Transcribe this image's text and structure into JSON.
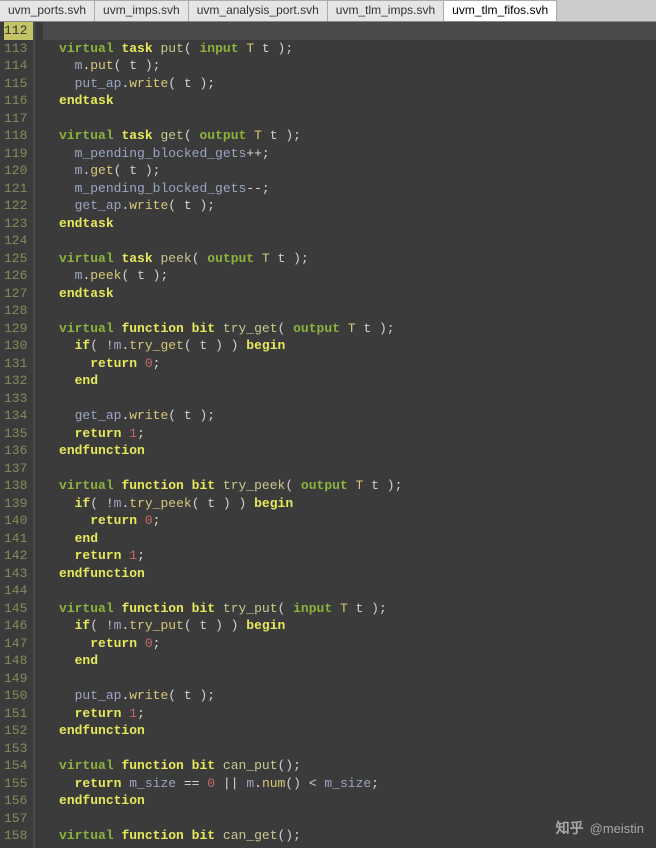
{
  "tabs": [
    {
      "label": "uvm_ports.svh",
      "active": false
    },
    {
      "label": "uvm_imps.svh",
      "active": false
    },
    {
      "label": "uvm_analysis_port.svh",
      "active": false
    },
    {
      "label": "uvm_tlm_imps.svh",
      "active": false
    },
    {
      "label": "uvm_tlm_fifos.svh",
      "active": true
    }
  ],
  "line_start": 112,
  "line_end": 158,
  "highlight_line": 112,
  "code_lines": [
    {
      "n": 112,
      "tokens": []
    },
    {
      "n": 113,
      "tokens": [
        {
          "t": "  ",
          "c": ""
        },
        {
          "t": "virtual",
          "c": "kw"
        },
        {
          "t": " ",
          "c": ""
        },
        {
          "t": "task",
          "c": "kw2"
        },
        {
          "t": " ",
          "c": ""
        },
        {
          "t": "put",
          "c": "fn"
        },
        {
          "t": "( ",
          "c": "paren"
        },
        {
          "t": "input",
          "c": "kw"
        },
        {
          "t": " ",
          "c": ""
        },
        {
          "t": "T",
          "c": "type"
        },
        {
          "t": " t );",
          "c": "paren"
        }
      ]
    },
    {
      "n": 114,
      "tokens": [
        {
          "t": "    ",
          "c": ""
        },
        {
          "t": "m",
          "c": "ident"
        },
        {
          "t": ".",
          "c": "op"
        },
        {
          "t": "put",
          "c": "call"
        },
        {
          "t": "( t );",
          "c": "paren"
        }
      ]
    },
    {
      "n": 115,
      "tokens": [
        {
          "t": "    ",
          "c": ""
        },
        {
          "t": "put_ap",
          "c": "ident"
        },
        {
          "t": ".",
          "c": "op"
        },
        {
          "t": "write",
          "c": "call"
        },
        {
          "t": "( t );",
          "c": "paren"
        }
      ]
    },
    {
      "n": 116,
      "tokens": [
        {
          "t": "  ",
          "c": ""
        },
        {
          "t": "endtask",
          "c": "kw2"
        }
      ]
    },
    {
      "n": 117,
      "tokens": []
    },
    {
      "n": 118,
      "tokens": [
        {
          "t": "  ",
          "c": ""
        },
        {
          "t": "virtual",
          "c": "kw"
        },
        {
          "t": " ",
          "c": ""
        },
        {
          "t": "task",
          "c": "kw2"
        },
        {
          "t": " ",
          "c": ""
        },
        {
          "t": "get",
          "c": "fn"
        },
        {
          "t": "( ",
          "c": "paren"
        },
        {
          "t": "output",
          "c": "kw"
        },
        {
          "t": " ",
          "c": ""
        },
        {
          "t": "T",
          "c": "type"
        },
        {
          "t": " t );",
          "c": "paren"
        }
      ]
    },
    {
      "n": 119,
      "tokens": [
        {
          "t": "    ",
          "c": ""
        },
        {
          "t": "m_pending_blocked_gets",
          "c": "ident"
        },
        {
          "t": "++;",
          "c": "op"
        }
      ]
    },
    {
      "n": 120,
      "tokens": [
        {
          "t": "    ",
          "c": ""
        },
        {
          "t": "m",
          "c": "ident"
        },
        {
          "t": ".",
          "c": "op"
        },
        {
          "t": "get",
          "c": "call"
        },
        {
          "t": "( t );",
          "c": "paren"
        }
      ]
    },
    {
      "n": 121,
      "tokens": [
        {
          "t": "    ",
          "c": ""
        },
        {
          "t": "m_pending_blocked_gets",
          "c": "ident"
        },
        {
          "t": "--;",
          "c": "op"
        }
      ]
    },
    {
      "n": 122,
      "tokens": [
        {
          "t": "    ",
          "c": ""
        },
        {
          "t": "get_ap",
          "c": "ident"
        },
        {
          "t": ".",
          "c": "op"
        },
        {
          "t": "write",
          "c": "call"
        },
        {
          "t": "( t );",
          "c": "paren"
        }
      ]
    },
    {
      "n": 123,
      "tokens": [
        {
          "t": "  ",
          "c": ""
        },
        {
          "t": "endtask",
          "c": "kw2"
        }
      ]
    },
    {
      "n": 124,
      "tokens": []
    },
    {
      "n": 125,
      "tokens": [
        {
          "t": "  ",
          "c": ""
        },
        {
          "t": "virtual",
          "c": "kw"
        },
        {
          "t": " ",
          "c": ""
        },
        {
          "t": "task",
          "c": "kw2"
        },
        {
          "t": " ",
          "c": ""
        },
        {
          "t": "peek",
          "c": "fn"
        },
        {
          "t": "( ",
          "c": "paren"
        },
        {
          "t": "output",
          "c": "kw"
        },
        {
          "t": " ",
          "c": ""
        },
        {
          "t": "T",
          "c": "type"
        },
        {
          "t": " t );",
          "c": "paren"
        }
      ]
    },
    {
      "n": 126,
      "tokens": [
        {
          "t": "    ",
          "c": ""
        },
        {
          "t": "m",
          "c": "ident"
        },
        {
          "t": ".",
          "c": "op"
        },
        {
          "t": "peek",
          "c": "call"
        },
        {
          "t": "( t );",
          "c": "paren"
        }
      ]
    },
    {
      "n": 127,
      "tokens": [
        {
          "t": "  ",
          "c": ""
        },
        {
          "t": "endtask",
          "c": "kw2"
        }
      ]
    },
    {
      "n": 128,
      "tokens": []
    },
    {
      "n": 129,
      "tokens": [
        {
          "t": "  ",
          "c": ""
        },
        {
          "t": "virtual",
          "c": "kw"
        },
        {
          "t": " ",
          "c": ""
        },
        {
          "t": "function",
          "c": "kw2"
        },
        {
          "t": " ",
          "c": ""
        },
        {
          "t": "bit",
          "c": "kw2"
        },
        {
          "t": " ",
          "c": ""
        },
        {
          "t": "try_get",
          "c": "fn"
        },
        {
          "t": "( ",
          "c": "paren"
        },
        {
          "t": "output",
          "c": "kw"
        },
        {
          "t": " ",
          "c": ""
        },
        {
          "t": "T",
          "c": "type"
        },
        {
          "t": " t );",
          "c": "paren"
        }
      ]
    },
    {
      "n": 130,
      "tokens": [
        {
          "t": "    ",
          "c": ""
        },
        {
          "t": "if",
          "c": "kw2"
        },
        {
          "t": "( !",
          "c": "paren"
        },
        {
          "t": "m",
          "c": "ident"
        },
        {
          "t": ".",
          "c": "op"
        },
        {
          "t": "try_get",
          "c": "call"
        },
        {
          "t": "( t ) ) ",
          "c": "paren"
        },
        {
          "t": "begin",
          "c": "kw2"
        }
      ]
    },
    {
      "n": 131,
      "tokens": [
        {
          "t": "      ",
          "c": ""
        },
        {
          "t": "return",
          "c": "kw2"
        },
        {
          "t": " ",
          "c": ""
        },
        {
          "t": "0",
          "c": "num"
        },
        {
          "t": ";",
          "c": "op"
        }
      ]
    },
    {
      "n": 132,
      "tokens": [
        {
          "t": "    ",
          "c": ""
        },
        {
          "t": "end",
          "c": "kw2"
        }
      ]
    },
    {
      "n": 133,
      "tokens": []
    },
    {
      "n": 134,
      "tokens": [
        {
          "t": "    ",
          "c": ""
        },
        {
          "t": "get_ap",
          "c": "ident"
        },
        {
          "t": ".",
          "c": "op"
        },
        {
          "t": "write",
          "c": "call"
        },
        {
          "t": "( t );",
          "c": "paren"
        }
      ]
    },
    {
      "n": 135,
      "tokens": [
        {
          "t": "    ",
          "c": ""
        },
        {
          "t": "return",
          "c": "kw2"
        },
        {
          "t": " ",
          "c": ""
        },
        {
          "t": "1",
          "c": "num"
        },
        {
          "t": ";",
          "c": "op"
        }
      ]
    },
    {
      "n": 136,
      "tokens": [
        {
          "t": "  ",
          "c": ""
        },
        {
          "t": "endfunction",
          "c": "kw2"
        }
      ]
    },
    {
      "n": 137,
      "tokens": []
    },
    {
      "n": 138,
      "tokens": [
        {
          "t": "  ",
          "c": ""
        },
        {
          "t": "virtual",
          "c": "kw"
        },
        {
          "t": " ",
          "c": ""
        },
        {
          "t": "function",
          "c": "kw2"
        },
        {
          "t": " ",
          "c": ""
        },
        {
          "t": "bit",
          "c": "kw2"
        },
        {
          "t": " ",
          "c": ""
        },
        {
          "t": "try_peek",
          "c": "fn"
        },
        {
          "t": "( ",
          "c": "paren"
        },
        {
          "t": "output",
          "c": "kw"
        },
        {
          "t": " ",
          "c": ""
        },
        {
          "t": "T",
          "c": "type"
        },
        {
          "t": " t );",
          "c": "paren"
        }
      ]
    },
    {
      "n": 139,
      "tokens": [
        {
          "t": "    ",
          "c": ""
        },
        {
          "t": "if",
          "c": "kw2"
        },
        {
          "t": "( !",
          "c": "paren"
        },
        {
          "t": "m",
          "c": "ident"
        },
        {
          "t": ".",
          "c": "op"
        },
        {
          "t": "try_peek",
          "c": "call"
        },
        {
          "t": "( t ) ) ",
          "c": "paren"
        },
        {
          "t": "begin",
          "c": "kw2"
        }
      ]
    },
    {
      "n": 140,
      "tokens": [
        {
          "t": "      ",
          "c": ""
        },
        {
          "t": "return",
          "c": "kw2"
        },
        {
          "t": " ",
          "c": ""
        },
        {
          "t": "0",
          "c": "num"
        },
        {
          "t": ";",
          "c": "op"
        }
      ]
    },
    {
      "n": 141,
      "tokens": [
        {
          "t": "    ",
          "c": ""
        },
        {
          "t": "end",
          "c": "kw2"
        }
      ]
    },
    {
      "n": 142,
      "tokens": [
        {
          "t": "    ",
          "c": ""
        },
        {
          "t": "return",
          "c": "kw2"
        },
        {
          "t": " ",
          "c": ""
        },
        {
          "t": "1",
          "c": "num"
        },
        {
          "t": ";",
          "c": "op"
        }
      ]
    },
    {
      "n": 143,
      "tokens": [
        {
          "t": "  ",
          "c": ""
        },
        {
          "t": "endfunction",
          "c": "kw2"
        }
      ]
    },
    {
      "n": 144,
      "tokens": []
    },
    {
      "n": 145,
      "tokens": [
        {
          "t": "  ",
          "c": ""
        },
        {
          "t": "virtual",
          "c": "kw"
        },
        {
          "t": " ",
          "c": ""
        },
        {
          "t": "function",
          "c": "kw2"
        },
        {
          "t": " ",
          "c": ""
        },
        {
          "t": "bit",
          "c": "kw2"
        },
        {
          "t": " ",
          "c": ""
        },
        {
          "t": "try_put",
          "c": "fn"
        },
        {
          "t": "( ",
          "c": "paren"
        },
        {
          "t": "input",
          "c": "kw"
        },
        {
          "t": " ",
          "c": ""
        },
        {
          "t": "T",
          "c": "type"
        },
        {
          "t": " t );",
          "c": "paren"
        }
      ]
    },
    {
      "n": 146,
      "tokens": [
        {
          "t": "    ",
          "c": ""
        },
        {
          "t": "if",
          "c": "kw2"
        },
        {
          "t": "( !",
          "c": "paren"
        },
        {
          "t": "m",
          "c": "ident"
        },
        {
          "t": ".",
          "c": "op"
        },
        {
          "t": "try_put",
          "c": "call"
        },
        {
          "t": "( t ) ) ",
          "c": "paren"
        },
        {
          "t": "begin",
          "c": "kw2"
        }
      ]
    },
    {
      "n": 147,
      "tokens": [
        {
          "t": "      ",
          "c": ""
        },
        {
          "t": "return",
          "c": "kw2"
        },
        {
          "t": " ",
          "c": ""
        },
        {
          "t": "0",
          "c": "num"
        },
        {
          "t": ";",
          "c": "op"
        }
      ]
    },
    {
      "n": 148,
      "tokens": [
        {
          "t": "    ",
          "c": ""
        },
        {
          "t": "end",
          "c": "kw2"
        }
      ]
    },
    {
      "n": 149,
      "tokens": []
    },
    {
      "n": 150,
      "tokens": [
        {
          "t": "    ",
          "c": ""
        },
        {
          "t": "put_ap",
          "c": "ident"
        },
        {
          "t": ".",
          "c": "op"
        },
        {
          "t": "write",
          "c": "call"
        },
        {
          "t": "( t );",
          "c": "paren"
        }
      ]
    },
    {
      "n": 151,
      "tokens": [
        {
          "t": "    ",
          "c": ""
        },
        {
          "t": "return",
          "c": "kw2"
        },
        {
          "t": " ",
          "c": ""
        },
        {
          "t": "1",
          "c": "num"
        },
        {
          "t": ";",
          "c": "op"
        }
      ]
    },
    {
      "n": 152,
      "tokens": [
        {
          "t": "  ",
          "c": ""
        },
        {
          "t": "endfunction",
          "c": "kw2"
        }
      ]
    },
    {
      "n": 153,
      "tokens": []
    },
    {
      "n": 154,
      "tokens": [
        {
          "t": "  ",
          "c": ""
        },
        {
          "t": "virtual",
          "c": "kw"
        },
        {
          "t": " ",
          "c": ""
        },
        {
          "t": "function",
          "c": "kw2"
        },
        {
          "t": " ",
          "c": ""
        },
        {
          "t": "bit",
          "c": "kw2"
        },
        {
          "t": " ",
          "c": ""
        },
        {
          "t": "can_put",
          "c": "fn"
        },
        {
          "t": "();",
          "c": "paren"
        }
      ]
    },
    {
      "n": 155,
      "tokens": [
        {
          "t": "    ",
          "c": ""
        },
        {
          "t": "return",
          "c": "kw2"
        },
        {
          "t": " ",
          "c": ""
        },
        {
          "t": "m_size",
          "c": "ident"
        },
        {
          "t": " == ",
          "c": "op"
        },
        {
          "t": "0",
          "c": "num"
        },
        {
          "t": " || ",
          "c": "op"
        },
        {
          "t": "m",
          "c": "ident"
        },
        {
          "t": ".",
          "c": "op"
        },
        {
          "t": "num",
          "c": "call"
        },
        {
          "t": "() < ",
          "c": "paren"
        },
        {
          "t": "m_size",
          "c": "ident"
        },
        {
          "t": ";",
          "c": "op"
        }
      ]
    },
    {
      "n": 156,
      "tokens": [
        {
          "t": "  ",
          "c": ""
        },
        {
          "t": "endfunction",
          "c": "kw2"
        }
      ]
    },
    {
      "n": 157,
      "tokens": []
    },
    {
      "n": 158,
      "tokens": [
        {
          "t": "  ",
          "c": ""
        },
        {
          "t": "virtual",
          "c": "kw"
        },
        {
          "t": " ",
          "c": ""
        },
        {
          "t": "function",
          "c": "kw2"
        },
        {
          "t": " ",
          "c": ""
        },
        {
          "t": "bit",
          "c": "kw2"
        },
        {
          "t": " ",
          "c": ""
        },
        {
          "t": "can_get",
          "c": "fn"
        },
        {
          "t": "();",
          "c": "paren"
        }
      ]
    }
  ],
  "watermark": {
    "brand": "知乎",
    "user": "@meistin"
  }
}
